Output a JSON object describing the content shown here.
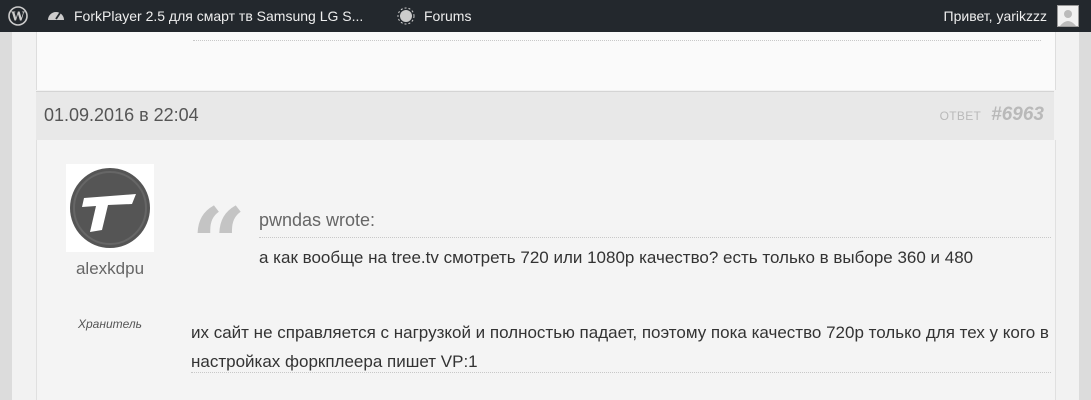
{
  "adminbar": {
    "site_title": "ForkPlayer 2.5 для смарт тв Samsung LG S...",
    "forums_label": "Forums",
    "greeting": "Привет, yarikzzz"
  },
  "reply": {
    "date": "01.09.2016 в 22:04",
    "type_label": "ОТВЕТ",
    "id": "#6963",
    "author": {
      "name": "alexkdpu",
      "role": "Хранитель",
      "avatar_icon": "forkplayer-logo-icon"
    },
    "quote": {
      "author": "pwndas wrote:",
      "text": "а как вообще на tree.tv смотреть 720 или 1080p качество? есть только в выборе 360 и 480"
    },
    "text": "их сайт не справляется с нагрузкой и полностью падает, поэтому пока качество 720p только для тех у кого в настройках форкплеера пишет VP:1"
  },
  "colors": {
    "adminbar_bg": "#23282d",
    "meta_gray": "#b9b9b9"
  }
}
